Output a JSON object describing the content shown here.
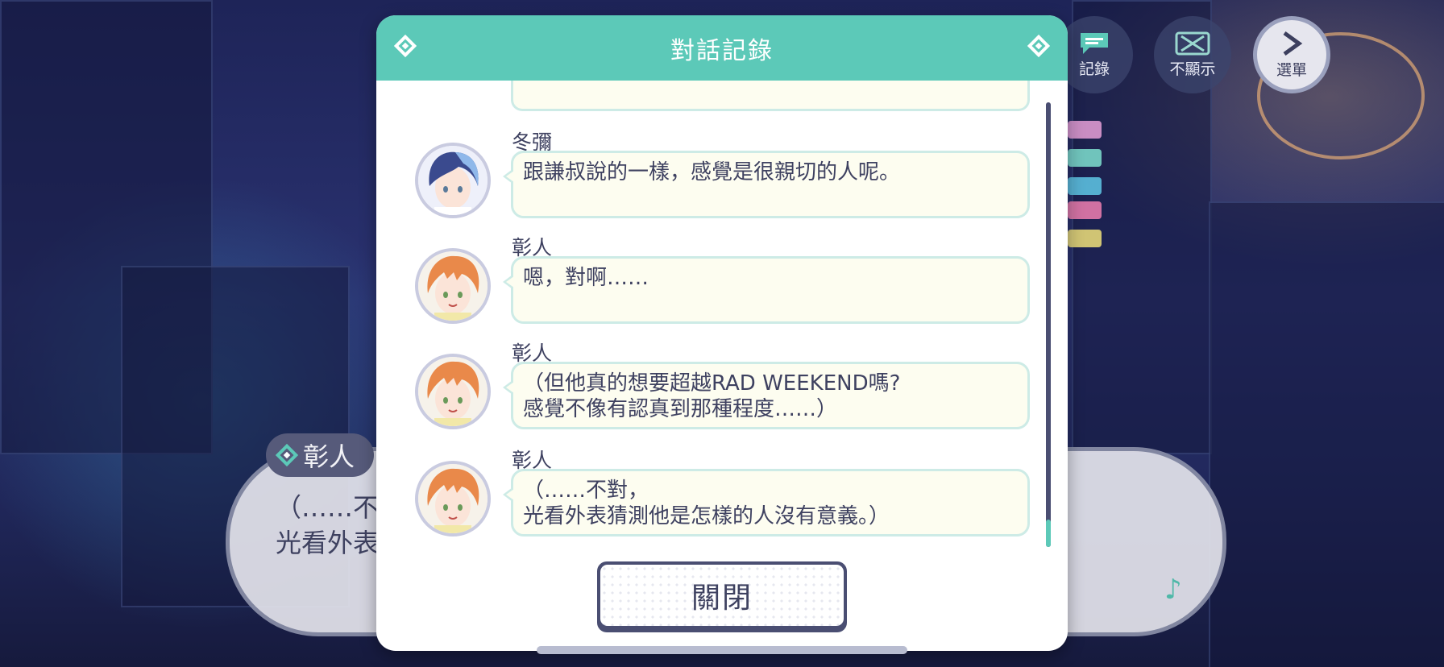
{
  "colors": {
    "accent": "#5cc9b8",
    "text": "#3e4160",
    "bubble_fill": "#fdfdf0",
    "bubble_border": "#cdebe6",
    "dark_frame": "#4a4e72"
  },
  "top_buttons": {
    "log": {
      "label": "記錄",
      "icon": "chat-bubble-icon"
    },
    "hide": {
      "label": "不顯示",
      "icon": "hide-ui-icon"
    },
    "menu": {
      "label": "選單",
      "icon": "chevron-right-icon"
    }
  },
  "background_dialog": {
    "speaker": "彰人",
    "line1": "（……不",
    "line2": "光看外表"
  },
  "modal": {
    "title": "對話記錄",
    "close_label": "關閉",
    "entries": [
      {
        "speaker": "冬彌",
        "text": "跟謙叔說的一樣，感覺是很親切的人呢。",
        "avatar": "blue-hair-character"
      },
      {
        "speaker": "彰人",
        "text": "嗯，對啊……",
        "avatar": "orange-hair-character"
      },
      {
        "speaker": "彰人",
        "text": "（但他真的想要超越RAD WEEKEND嗎?\n感覺不像有認真到那種程度……）",
        "avatar": "orange-hair-character"
      },
      {
        "speaker": "彰人",
        "text": "（……不對，\n光看外表猜測他是怎樣的人沒有意義。）",
        "avatar": "orange-hair-character"
      }
    ]
  }
}
